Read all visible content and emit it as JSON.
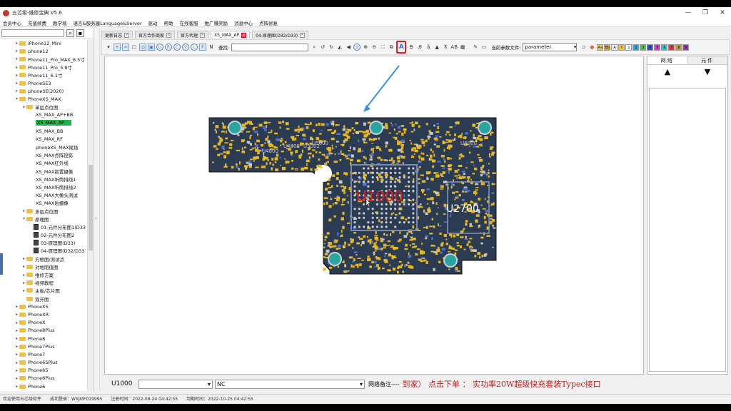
{
  "window": {
    "title": "五芯级-维修宝典 V5.6",
    "min": "—",
    "max": "❐",
    "close": "✕"
  },
  "menu": [
    "会员中心",
    "充值续费",
    "教学墙",
    "语言&服务器Language&Server",
    "驱动",
    "帮助",
    "在线客服",
    "推广赚奖励",
    "消息中心",
    "点阵修复"
  ],
  "tree": [
    {
      "label": "iPhone12_Mini",
      "lv": 2,
      "type": "folder",
      "tog": "▸"
    },
    {
      "label": "phone12",
      "lv": 2,
      "type": "folder",
      "tog": "▸"
    },
    {
      "label": "Phone11_Pro_MAX_6.5寸",
      "lv": 2,
      "type": "folder",
      "tog": "▸"
    },
    {
      "label": "Phone11_Pro_5.8寸",
      "lv": 2,
      "type": "folder",
      "tog": "▸"
    },
    {
      "label": "Phone11_6.1寸",
      "lv": 2,
      "type": "folder",
      "tog": "▸"
    },
    {
      "label": "PhoneSE3",
      "lv": 2,
      "type": "folder",
      "tog": "▸"
    },
    {
      "label": "phoneSE(2020)",
      "lv": 2,
      "type": "folder",
      "tog": "▸"
    },
    {
      "label": "PhoneXS_MAX",
      "lv": 2,
      "type": "folder",
      "tog": "▾"
    },
    {
      "label": "单层点位图",
      "lv": 3,
      "type": "folder",
      "tog": "▾"
    },
    {
      "label": "XS_MAX_AP+BB",
      "lv": 4,
      "type": "file"
    },
    {
      "label": "XS_MAX_AP",
      "lv": 4,
      "type": "file",
      "sel": true
    },
    {
      "label": "XS_MAX_BB",
      "lv": 4,
      "type": "file"
    },
    {
      "label": "XS_MAX_RF",
      "lv": 4,
      "type": "file"
    },
    {
      "label": "phoneXS_MAX尾插",
      "lv": 4,
      "type": "file"
    },
    {
      "label": "XS_MAX点阵投影",
      "lv": 4,
      "type": "file"
    },
    {
      "label": "XS_MAX红外线",
      "lv": 4,
      "type": "file"
    },
    {
      "label": "XS_MAX前置摄像",
      "lv": 4,
      "type": "file"
    },
    {
      "label": "XS_MAX听筒排线1",
      "lv": 4,
      "type": "file"
    },
    {
      "label": "XS_MAX听筒排线2",
      "lv": 4,
      "type": "file"
    },
    {
      "label": "XS_MAX大像头测试",
      "lv": 4,
      "type": "file"
    },
    {
      "label": "XS_MAX后摄像",
      "lv": 4,
      "type": "file"
    },
    {
      "label": "多层点位图",
      "lv": 3,
      "type": "folder",
      "tog": "▸"
    },
    {
      "label": "原理图",
      "lv": 3,
      "type": "folder",
      "tog": "▾"
    },
    {
      "label": "01-元件分布图1(D33",
      "lv": 4,
      "type": "doc"
    },
    {
      "label": "02-元件分布图2",
      "lv": 4,
      "type": "doc"
    },
    {
      "label": "03-原理图(D33)",
      "lv": 4,
      "type": "doc"
    },
    {
      "label": "04-原理图(D32/D33",
      "lv": 4,
      "type": "doc"
    },
    {
      "label": "方框图/测试点",
      "lv": 3,
      "type": "folder",
      "tog": "▸"
    },
    {
      "label": "对地阻值图",
      "lv": 3,
      "type": "folder",
      "tog": "▸"
    },
    {
      "label": "维修方案",
      "lv": 3,
      "type": "folder",
      "tog": "▸"
    },
    {
      "label": "视频教程",
      "lv": 3,
      "type": "folder",
      "tog": "▸"
    },
    {
      "label": "主板/芯片图",
      "lv": 3,
      "type": "folder",
      "tog": "▸"
    },
    {
      "label": "双开图",
      "lv": 3,
      "type": "folder",
      "tog": ""
    },
    {
      "label": "PhoneXS",
      "lv": 2,
      "type": "folder",
      "tog": "▸"
    },
    {
      "label": "PhoneXR",
      "lv": 2,
      "type": "folder",
      "tog": "▸"
    },
    {
      "label": "PhoneX",
      "lv": 2,
      "type": "folder",
      "tog": "▸"
    },
    {
      "label": "Phone8Plus",
      "lv": 2,
      "type": "folder",
      "tog": "▸"
    },
    {
      "label": "Phone8",
      "lv": 2,
      "type": "folder",
      "tog": "▸"
    },
    {
      "label": "Phone7Plus",
      "lv": 2,
      "type": "folder",
      "tog": "▸"
    },
    {
      "label": "Phone7",
      "lv": 2,
      "type": "folder",
      "tog": "▸"
    },
    {
      "label": "Phone6SPlus",
      "lv": 2,
      "type": "folder",
      "tog": "▸"
    },
    {
      "label": "Phone6S",
      "lv": 2,
      "type": "folder",
      "tog": "▸"
    },
    {
      "label": "Phone6Plus",
      "lv": 2,
      "type": "folder",
      "tog": "▸"
    },
    {
      "label": "Phone6",
      "lv": 2,
      "type": "folder",
      "tog": "▸"
    }
  ],
  "tabs": [
    {
      "label": "更新日志",
      "active": false
    },
    {
      "label": "官方合作商家",
      "active": false
    },
    {
      "label": "官方代理",
      "active": false
    },
    {
      "label": "XS_MAX_AP",
      "active": true
    },
    {
      "label": "04-原理图(D32/D33)",
      "active": false
    }
  ],
  "toolbar": {
    "find_label": "查找:",
    "param_label": "当前参数文件:",
    "param_value": "parameter",
    "highlight_glyph": "A",
    "swatches": [
      {
        "t": "Aa",
        "c": "#f6d04d"
      },
      {
        "t": "Bb",
        "c": "#f6a623"
      },
      {
        "t": "A",
        "c": "#eeeeee"
      },
      {
        "t": "T",
        "c": "#f5c518"
      },
      {
        "t": "1",
        "c": "#f7f7f7"
      },
      {
        "t": "2",
        "c": "#22aaee"
      },
      {
        "t": "3",
        "c": "#44cc44"
      },
      {
        "t": "4",
        "c": "#2255dd"
      },
      {
        "t": "5",
        "c": "#dd33dd"
      },
      {
        "t": "6",
        "c": "#22cccc"
      },
      {
        "t": "7",
        "c": "#ee3333"
      },
      {
        "t": "8",
        "c": "#cc9922"
      },
      {
        "t": "9",
        "c": "#aa33aa"
      }
    ]
  },
  "board": {
    "labels": [
      "U1000",
      "U2700",
      "U5000",
      "U5002",
      "U4000",
      "U6000",
      "U4800"
    ],
    "accent": "#e02020",
    "board_color": "#2b3b52",
    "pad_color": "#e8b822"
  },
  "right_panel": {
    "tab1": "网络",
    "tab2": "元件",
    "up": "▲",
    "down": "▼"
  },
  "bottom": {
    "component": "U1000",
    "combo1": "",
    "combo2": "NC",
    "net_label": "网络备注----",
    "marquee": "到家）   点击下单 ： 实功率20W超级快充套装Typec接口"
  },
  "status": {
    "welcome": "欢迎使用五芯级软件",
    "login": "成功登录：WXJMF019995",
    "reg": "注册时间：2022-08-24 04:42:55",
    "expire": "到期时间：2022-10-25 04:42:55"
  }
}
